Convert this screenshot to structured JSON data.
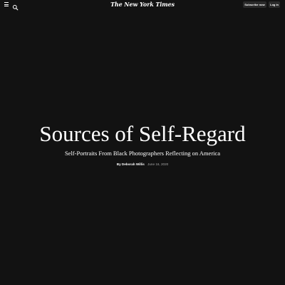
{
  "header": {
    "masthead": "The New York Times",
    "menu_icon": "hamburger-menu-icon",
    "search_icon": "search-icon",
    "subscribe_label": "Subscribe now",
    "login_label": "Log in"
  },
  "article": {
    "title": "Sources of Self-Regard",
    "subtitle": "Self-Portraits From Black Photographers Reflecting on America",
    "byline_author": "By Deborah Willis",
    "date": "June 16, 2020"
  },
  "colors": {
    "background": "#121212",
    "text": "#ffffff",
    "muted_text": "#a8a8a8",
    "button_bg": "#2a2a2a"
  }
}
